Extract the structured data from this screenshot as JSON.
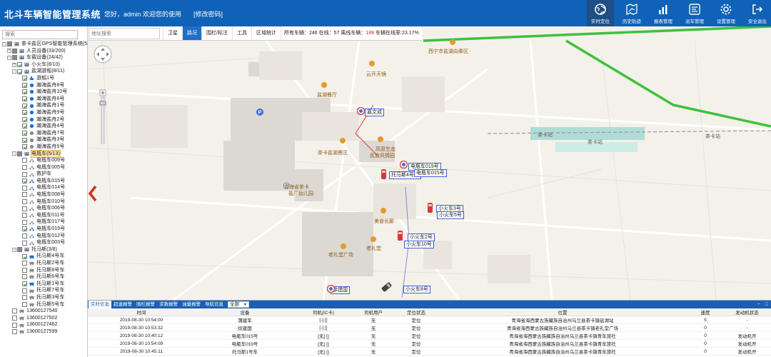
{
  "header": {
    "title": "北斗车辆智能管理系统",
    "welcome": "您好，admin 欢迎您的使用",
    "change_password": "[修改密码]",
    "nav": [
      {
        "label": "实时定位",
        "icon": "globe-icon",
        "active": true
      },
      {
        "label": "历史轨迹",
        "icon": "map-route-icon",
        "active": false
      },
      {
        "label": "报表管理",
        "icon": "bar-chart-icon",
        "active": false
      },
      {
        "label": "派车管理",
        "icon": "dispatch-icon",
        "active": false
      },
      {
        "label": "设置管理",
        "icon": "gear-icon",
        "active": false
      },
      {
        "label": "安全退出",
        "icon": "logout-icon",
        "active": false
      }
    ]
  },
  "sidebar": {
    "search_placeholder": "搜索",
    "tree": [
      {
        "indent": 0,
        "toggle": "-",
        "check": "part",
        "icon": "building",
        "label": "茶卡盐区GPS智能管理系统(57"
      },
      {
        "indent": 1,
        "toggle": "+",
        "check": "part",
        "icon": "building",
        "label": "人员设备(33/200)"
      },
      {
        "indent": 1,
        "toggle": "-",
        "check": "part",
        "icon": "building",
        "label": "车载设备(24/42)"
      },
      {
        "indent": 2,
        "toggle": "+",
        "check": "on",
        "icon": "building",
        "label": "小火车(8/10)"
      },
      {
        "indent": 2,
        "toggle": "-",
        "check": "on",
        "icon": "building",
        "label": "盐湖游船(8/11)"
      },
      {
        "indent": 3,
        "toggle": "",
        "check": "on",
        "icon": "ship",
        "label": "游船1号"
      },
      {
        "indent": 3,
        "toggle": "",
        "check": "on",
        "icon": "drop",
        "label": "瀚海盐舟8号"
      },
      {
        "indent": 3,
        "toggle": "",
        "check": "on",
        "icon": "drop",
        "label": "瀚海盐舟10号"
      },
      {
        "indent": 3,
        "toggle": "",
        "check": "on",
        "icon": "drop",
        "label": "瀚海盐舟6号"
      },
      {
        "indent": 3,
        "toggle": "",
        "check": "on",
        "icon": "drop",
        "label": "瀚海盐舟1号"
      },
      {
        "indent": 3,
        "toggle": "",
        "check": "on",
        "icon": "drop",
        "label": "瀚海盐舟9号"
      },
      {
        "indent": 3,
        "toggle": "",
        "check": "on",
        "icon": "drop",
        "label": "瀚海盐舟2号"
      },
      {
        "indent": 3,
        "toggle": "",
        "check": "on",
        "icon": "drop",
        "label": "瀚海盐舟4号"
      },
      {
        "indent": 3,
        "toggle": "",
        "check": "on",
        "icon": "drop-gray",
        "label": "瀚海盐舟7号"
      },
      {
        "indent": 3,
        "toggle": "",
        "check": "on",
        "icon": "drop-gray",
        "label": "瀚海盐舟3号"
      },
      {
        "indent": 3,
        "toggle": "",
        "check": "on",
        "icon": "drop-gray",
        "label": "瀚海盐舟5号"
      },
      {
        "indent": 2,
        "toggle": "-",
        "check": "part",
        "icon": "building",
        "label": "电瓶车(5/13)",
        "highlight": true
      },
      {
        "indent": 3,
        "toggle": "",
        "check": "off",
        "icon": "scooter-gray",
        "label": "电瓶车009号"
      },
      {
        "indent": 3,
        "toggle": "",
        "check": "off",
        "icon": "scooter-gray",
        "label": "电瓶车005号"
      },
      {
        "indent": 3,
        "toggle": "",
        "check": "off",
        "icon": "scooter-gray",
        "label": "救护车"
      },
      {
        "indent": 3,
        "toggle": "",
        "check": "on",
        "icon": "scooter",
        "label": "电瓶车015号"
      },
      {
        "indent": 3,
        "toggle": "",
        "check": "off",
        "icon": "scooter-gray",
        "label": "电瓶车014号"
      },
      {
        "indent": 3,
        "toggle": "",
        "check": "off",
        "icon": "scooter-gray",
        "label": "电瓶车008号"
      },
      {
        "indent": 3,
        "toggle": "",
        "check": "off",
        "icon": "scooter-gray",
        "label": "电瓶车010号"
      },
      {
        "indent": 3,
        "toggle": "",
        "check": "off",
        "icon": "scooter-gray",
        "label": "电瓶车006号"
      },
      {
        "indent": 3,
        "toggle": "",
        "check": "off",
        "icon": "scooter-gray",
        "label": "电瓶车011号"
      },
      {
        "indent": 3,
        "toggle": "",
        "check": "off",
        "icon": "scooter-gray",
        "label": "电瓶车017号"
      },
      {
        "indent": 3,
        "toggle": "",
        "check": "on",
        "icon": "scooter",
        "label": "电瓶车019号"
      },
      {
        "indent": 3,
        "toggle": "",
        "check": "off",
        "icon": "scooter-gray",
        "label": "电瓶车012号"
      },
      {
        "indent": 3,
        "toggle": "",
        "check": "off",
        "icon": "scooter-gray",
        "label": "电瓶车003号"
      },
      {
        "indent": 2,
        "toggle": "-",
        "check": "part",
        "icon": "building",
        "label": "托马斯(3/8)"
      },
      {
        "indent": 3,
        "toggle": "",
        "check": "on",
        "icon": "car",
        "label": "托马斯4号车"
      },
      {
        "indent": 3,
        "toggle": "",
        "check": "off",
        "icon": "car-gray",
        "label": "托马斯2号车"
      },
      {
        "indent": 3,
        "toggle": "",
        "check": "off",
        "icon": "car-gray",
        "label": "托马斯8号车"
      },
      {
        "indent": 3,
        "toggle": "",
        "check": "off",
        "icon": "car-gray",
        "label": "托马斯6号车"
      },
      {
        "indent": 3,
        "toggle": "",
        "check": "on",
        "icon": "car",
        "label": "托马斯1号车"
      },
      {
        "indent": 3,
        "toggle": "",
        "check": "off",
        "icon": "car-gray",
        "label": "托马斯7号车"
      },
      {
        "indent": 3,
        "toggle": "",
        "check": "off",
        "icon": "car-gray",
        "label": "托马斯3号车"
      },
      {
        "indent": 3,
        "toggle": "",
        "check": "off",
        "icon": "car-gray",
        "label": "托马斯5号车"
      },
      {
        "indent": 1,
        "toggle": "",
        "check": "off",
        "icon": "car-gray",
        "label": "13600127540"
      },
      {
        "indent": 1,
        "toggle": "",
        "check": "off",
        "icon": "car-gray",
        "label": "13600127502"
      },
      {
        "indent": 1,
        "toggle": "",
        "check": "off",
        "icon": "car-gray",
        "label": "13600127462"
      },
      {
        "indent": 1,
        "toggle": "",
        "check": "off",
        "icon": "car-gray",
        "label": "13600127599"
      }
    ]
  },
  "map": {
    "address_placeholder": "地址搜索",
    "tools": [
      {
        "label": "卫星",
        "active": false
      },
      {
        "label": "路况",
        "active": true
      },
      {
        "label": "围栏/标注",
        "active": false
      },
      {
        "label": "工具",
        "active": false
      },
      {
        "label": "区域统计",
        "active": false
      }
    ],
    "stats": {
      "prefix": "所有车辆：",
      "total": "246",
      "online_label": " 在线：",
      "online": "57",
      "offline_label": " 离线车辆：",
      "offline": "189",
      "rate_label": " 车辆在线率:",
      "rate": "23.17%"
    },
    "places": [
      {
        "label": "西宁市盐湖向秦区",
        "icon": "poi-food"
      },
      {
        "label": "云开天镜",
        "icon": "poi-food"
      },
      {
        "label": "盐湖餐厅",
        "icon": "poi-food"
      },
      {
        "label": "茶卡盐湖景区",
        "icon": "poi-food"
      },
      {
        "label": "高原生态",
        "icon": "poi-food"
      },
      {
        "label": "民族风情园",
        "icon": "none"
      },
      {
        "label": "青海省茶卡",
        "icon": "poi-school"
      },
      {
        "label": "盐厂幼儿园",
        "icon": "none"
      },
      {
        "label": "美食长廊",
        "icon": "poi-food"
      },
      {
        "label": "老礼堂",
        "icon": "poi-food"
      },
      {
        "label": "老礼堂广场",
        "icon": "poi-food"
      },
      {
        "label": "茶卡站",
        "icon": "none"
      },
      {
        "label": "茶卡站",
        "icon": "none"
      },
      {
        "label": "茶卡站",
        "icon": "none"
      }
    ],
    "vehicles": [
      {
        "label": "嘉文成",
        "kind": "person"
      },
      {
        "label": "电瓶车019号",
        "kind": "person"
      },
      {
        "label": "托马斯4号车",
        "kind": "car"
      },
      {
        "label": "电瓶车015号",
        "kind": "none"
      },
      {
        "label": "小火车3号",
        "kind": "car"
      },
      {
        "label": "小火车5号",
        "kind": "none"
      },
      {
        "label": "小火车2号",
        "kind": "car"
      },
      {
        "label": "小火车10号",
        "kind": "none"
      },
      {
        "label": "徐建国",
        "kind": "person"
      },
      {
        "label": "小火车8号",
        "kind": "car-dark"
      }
    ]
  },
  "bottom": {
    "tabs": [
      {
        "label": "实时信息",
        "active": true
      },
      {
        "label": "超速报警",
        "active": false
      },
      {
        "label": "围栏报警",
        "active": false
      },
      {
        "label": "求救报警",
        "active": false
      },
      {
        "label": "油量报警",
        "active": false
      },
      {
        "label": "导航信息",
        "active": false
      }
    ],
    "filter_value": "全部",
    "columns": [
      "时间",
      "设备",
      "司机(IC卡)",
      "司机用户",
      "定位状态",
      "位置",
      "速度",
      "发动机状态"
    ],
    "rows": [
      [
        "2019-08-30 10:54:00",
        "蒲建军",
        "[-] []",
        "无",
        "定位",
        "青海省海西蒙古族藏族自治州乌兰县茶卡镇盐湖站",
        "5",
        "-"
      ],
      [
        "2019-08-30 10:53:32",
        "徐建国",
        "[-] []",
        "无",
        "定位",
        "青海省海西蒙古族藏族自治州乌兰县茶卡镇老礼堂广场",
        "0",
        "-"
      ],
      [
        "2019-08-30 10:40:12",
        "电瓶车015号",
        "[无] []",
        "无",
        "定位",
        "青海省海西蒙古族藏族自治州乌兰县茶卡镇青年旅社",
        "0",
        "发动机开"
      ],
      [
        "2019-08-30 10:54:09",
        "电瓶车019号",
        "[无] []",
        "无",
        "定位",
        "青海省海西蒙古族藏族自治州乌兰县茶卡镇青年旅社",
        "0",
        "发动机开"
      ],
      [
        "2019-08-30 10:45:11",
        "托马斯1号车",
        "[无] []",
        "无",
        "定位",
        "青海省海西蒙古族藏族自治州乌兰县茶卡镇青年旅社",
        "0",
        "发动机开"
      ]
    ]
  }
}
